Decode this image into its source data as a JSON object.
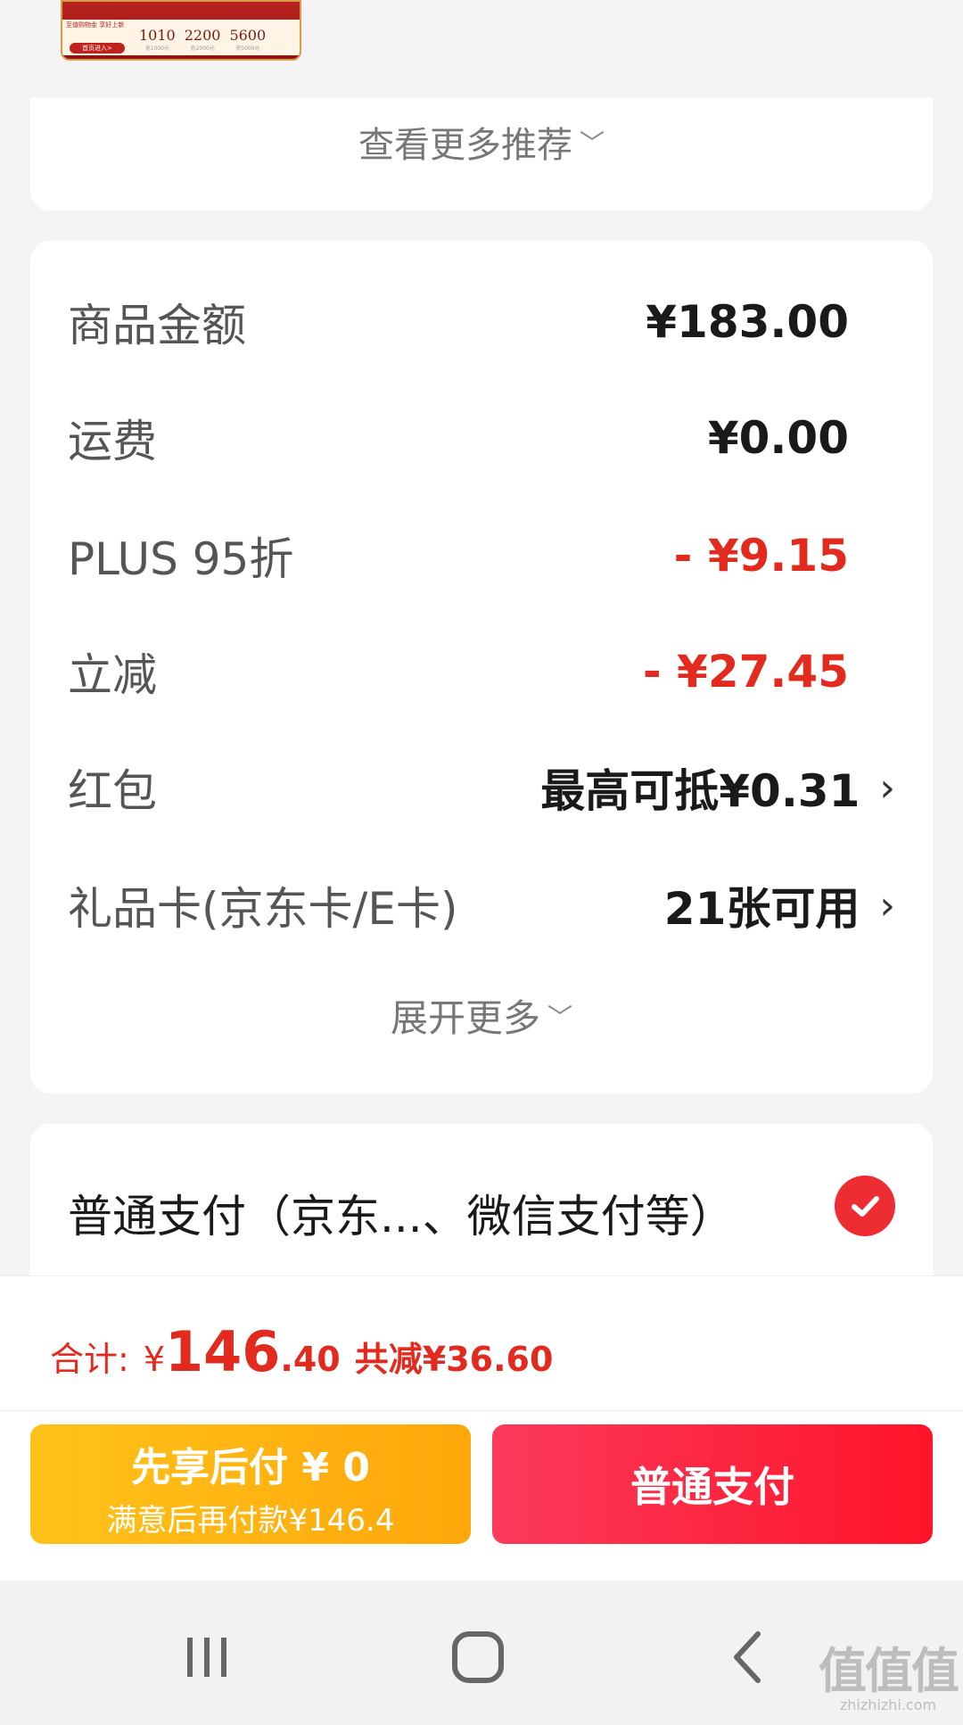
{
  "banner": {
    "side_text": "至值购物金 享好上新",
    "cta": "首页进入>",
    "amounts": [
      {
        "value": "1010",
        "note": "充1000元"
      },
      {
        "value": "2200",
        "note": "充2000元"
      },
      {
        "value": "5600",
        "note": "充5000元"
      }
    ]
  },
  "recommend": {
    "more_label": "查看更多推荐"
  },
  "price_detail": {
    "rows": [
      {
        "label": "商品金额",
        "value": "¥183.00"
      },
      {
        "label": "运费",
        "value": "¥0.00"
      },
      {
        "label": "PLUS 95折",
        "value": "- ¥9.15"
      },
      {
        "label": "立减",
        "value": "- ¥27.45"
      },
      {
        "label": "红包",
        "value": "最高可抵¥0.31"
      },
      {
        "label": "礼品卡(京东卡/E卡)",
        "value": "21张可用"
      }
    ],
    "expand_label": "展开更多"
  },
  "payment": {
    "method_label": "普通支付（京东...、微信支付等）"
  },
  "summary": {
    "label": "合计:",
    "currency": "¥",
    "total_int": "146",
    "total_dec": ".40",
    "savings": "共减¥36.60"
  },
  "actions": {
    "pay_later_title": "先享后付 ¥ 0",
    "pay_later_sub": "满意后再付款¥146.4",
    "pay_now": "普通支付"
  },
  "watermark": {
    "logo": "值值值",
    "url": "zhizhizhi.com"
  },
  "colors": {
    "accent_red": "#e22a1f",
    "pay_gradient": [
      "#fb3a5c",
      "#ff1428"
    ],
    "later_gradient": [
      "#ffc21a",
      "#ffa70a"
    ]
  },
  "icons": [
    "chevron-down-icon",
    "chevron-right-icon",
    "checkmark-icon",
    "recents-icon",
    "home-icon",
    "back-icon"
  ]
}
